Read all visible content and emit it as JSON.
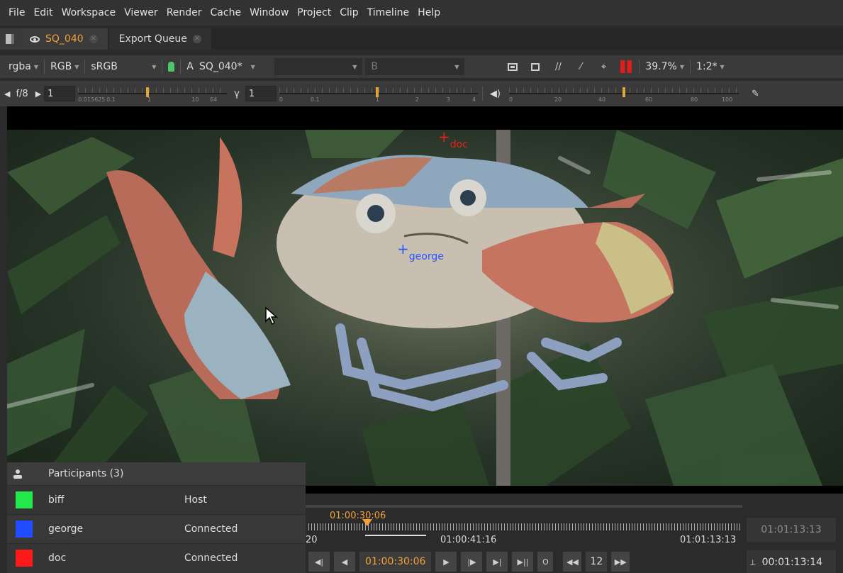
{
  "menu": [
    "File",
    "Edit",
    "Workspace",
    "Viewer",
    "Render",
    "Cache",
    "Window",
    "Project",
    "Clip",
    "Timeline",
    "Help"
  ],
  "tabs": {
    "active": "SQ_040",
    "inactive": "Export Queue"
  },
  "viewer_toolbar": {
    "channels": "rgba",
    "color_mode": "RGB",
    "colorspace": "sRGB",
    "a_label": "A",
    "a_clip": "SQ_040*",
    "b_label": "B",
    "zoom": "39.7%",
    "proxy": "1:2*",
    "accent_red": "#e21b1b",
    "lock_color": "#4cc56e"
  },
  "exposure_bar": {
    "fstop_label": "f/8",
    "gain_value": "1",
    "gain_ticks": [
      "0.015625",
      "0.1",
      "1",
      "10",
      "64"
    ],
    "gamma_label": "γ",
    "gamma_value": "1",
    "gamma_ticks": [
      "0",
      "0.1",
      "1",
      "2",
      "3",
      "4"
    ],
    "volume_ticks": [
      "0",
      "20",
      "40",
      "60",
      "80",
      "100"
    ]
  },
  "viewer": {
    "cursors": [
      {
        "name": "doc",
        "color": "#e52020"
      },
      {
        "name": "george",
        "color": "#2957ff"
      }
    ]
  },
  "participants": {
    "title": "Participants (3)",
    "rows": [
      {
        "name": "biff",
        "status": "Host",
        "color": "#22e84a"
      },
      {
        "name": "george",
        "status": "Connected",
        "color": "#1f4dff"
      },
      {
        "name": "doc",
        "status": "Connected",
        "color": "#ff1a1a"
      }
    ]
  },
  "timeline": {
    "current_time": "01:00:30:06",
    "left_label": "20",
    "mid_label": "01:00:41:16",
    "right_label": "01:01:13:13",
    "out_time": "01:01:13:13",
    "duration": "00:01:13:14",
    "step": "12",
    "playhead_color": "#f2a03a"
  }
}
